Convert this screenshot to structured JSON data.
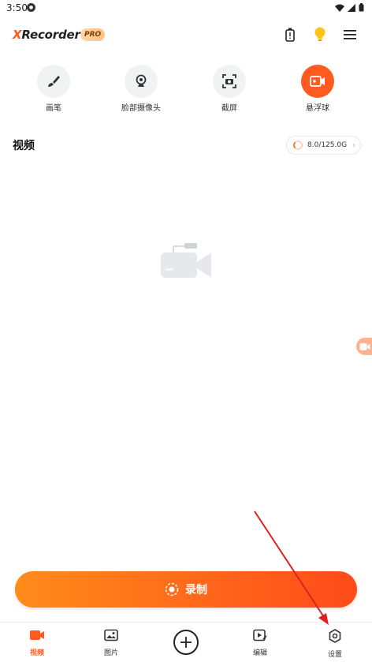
{
  "status_bar": {
    "time": "3:50"
  },
  "header": {
    "logo_prefix": "X",
    "logo_rest": "Recorder",
    "pro_badge": "PRO"
  },
  "tools": [
    {
      "label": "画笔",
      "icon": "brush-icon"
    },
    {
      "label": "脸部摄像头",
      "icon": "webcam-icon"
    },
    {
      "label": "截屏",
      "icon": "screenshot-icon"
    },
    {
      "label": "悬浮球",
      "icon": "floating-ball-icon",
      "active": true
    }
  ],
  "section": {
    "title": "视频",
    "storage": "8.0/125.0G"
  },
  "record": {
    "label": "录制"
  },
  "bottom_nav": [
    {
      "label": "视频",
      "icon": "video-icon",
      "active": true
    },
    {
      "label": "图片",
      "icon": "image-icon"
    },
    {
      "label": "编辑",
      "icon": "edit-icon"
    },
    {
      "label": "设置",
      "icon": "settings-icon"
    }
  ],
  "colors": {
    "accent": "#ff5a1f",
    "gradient_start": "#ff8c1a",
    "gradient_end": "#ff4a1a",
    "annotation": "#e02020"
  }
}
